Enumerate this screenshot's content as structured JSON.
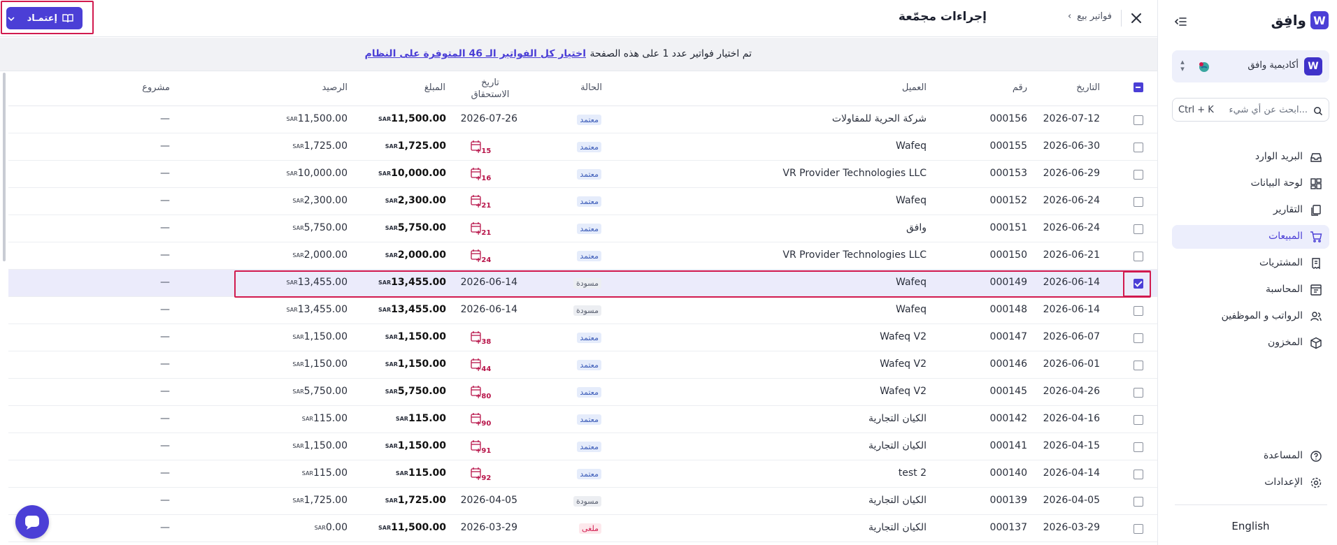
{
  "brand": {
    "logo_text": "وافِق",
    "logo_mark": "W"
  },
  "org": {
    "name": "أكاديمية وافق",
    "logo_mark": "W"
  },
  "search": {
    "placeholder": "ابحث عن أي شيء...",
    "shortcut": "Ctrl + K"
  },
  "nav": [
    {
      "label": "البريد الوارد",
      "icon": "inbox-icon"
    },
    {
      "label": "لوحة البيانات",
      "icon": "dashboard-icon"
    },
    {
      "label": "التقارير",
      "icon": "reports-icon"
    },
    {
      "label": "المبيعات",
      "icon": "cart-icon",
      "active": true
    },
    {
      "label": "المشتريات",
      "icon": "receipt-icon"
    },
    {
      "label": "المحاسبة",
      "icon": "ledger-icon"
    },
    {
      "label": "الرواتب و الموظفين",
      "icon": "users-icon"
    },
    {
      "label": "المخزون",
      "icon": "box-icon"
    }
  ],
  "bottom_nav": [
    {
      "label": "المساعدة",
      "icon": "help-icon"
    },
    {
      "label": "الإعدادات",
      "icon": "settings-icon"
    }
  ],
  "language": "English",
  "header": {
    "title": "إجراءات مجمّعة",
    "breadcrumb": [
      "فواتير بيع"
    ],
    "approve_button": "إعتمـاد"
  },
  "selection": {
    "text": "تم اختيار فواتير عدد 1 على هذه الصفحة",
    "link": "اختيار كل الفواتير الـ 46 المتوفرة على النظام"
  },
  "columns": {
    "date": "التاريخ",
    "number": "رقم",
    "client": "العميل",
    "status": "الحالة",
    "due_date": "تاريخ الاستحقاق",
    "amount": "المبلغ",
    "balance": "الرصيد",
    "project": "مشروع"
  },
  "currency": "SAR",
  "colors": {
    "accent": "#4b3fd6",
    "highlight": "#d11a4e",
    "overdue": "#b8154a"
  },
  "rows": [
    {
      "date": "2026-07-12",
      "number": "000156",
      "client": "شركة الحرية للمقاولات",
      "status": "معتمد",
      "status_type": "approved",
      "due": "2026-07-26",
      "due_days": "",
      "amount": "11,500.00",
      "balance": "11,500.00",
      "project": "—",
      "checked": false
    },
    {
      "date": "2026-06-30",
      "number": "000155",
      "client": "Wafeq",
      "status": "معتمد",
      "status_type": "approved",
      "due": "",
      "due_days": "+15",
      "amount": "1,725.00",
      "balance": "1,725.00",
      "project": "—",
      "checked": false
    },
    {
      "date": "2026-06-29",
      "number": "000153",
      "client": "VR Provider Technologies LLC",
      "status": "معتمد",
      "status_type": "approved",
      "due": "",
      "due_days": "+16",
      "amount": "10,000.00",
      "balance": "10,000.00",
      "project": "—",
      "checked": false
    },
    {
      "date": "2026-06-24",
      "number": "000152",
      "client": "Wafeq",
      "status": "معتمد",
      "status_type": "approved",
      "due": "",
      "due_days": "+21",
      "amount": "2,300.00",
      "balance": "2,300.00",
      "project": "—",
      "checked": false
    },
    {
      "date": "2026-06-24",
      "number": "000151",
      "client": "وافق",
      "status": "معتمد",
      "status_type": "approved",
      "due": "",
      "due_days": "+21",
      "amount": "5,750.00",
      "balance": "5,750.00",
      "project": "—",
      "checked": false
    },
    {
      "date": "2026-06-21",
      "number": "000150",
      "client": "VR Provider Technologies LLC",
      "status": "معتمد",
      "status_type": "approved",
      "due": "",
      "due_days": "+24",
      "amount": "2,000.00",
      "balance": "2,000.00",
      "project": "—",
      "checked": false
    },
    {
      "date": "2026-06-14",
      "number": "000149",
      "client": "Wafeq",
      "status": "مسودة",
      "status_type": "draft",
      "due": "2026-06-14",
      "due_days": "",
      "amount": "13,455.00",
      "balance": "13,455.00",
      "project": "—",
      "checked": true
    },
    {
      "date": "2026-06-14",
      "number": "000148",
      "client": "Wafeq",
      "status": "مسودة",
      "status_type": "draft",
      "due": "2026-06-14",
      "due_days": "",
      "amount": "13,455.00",
      "balance": "13,455.00",
      "project": "—",
      "checked": false
    },
    {
      "date": "2026-06-07",
      "number": "000147",
      "client": "Wafeq V2",
      "status": "معتمد",
      "status_type": "approved",
      "due": "",
      "due_days": "+38",
      "amount": "1,150.00",
      "balance": "1,150.00",
      "project": "—",
      "checked": false
    },
    {
      "date": "2026-06-01",
      "number": "000146",
      "client": "Wafeq V2",
      "status": "معتمد",
      "status_type": "approved",
      "due": "",
      "due_days": "+44",
      "amount": "1,150.00",
      "balance": "1,150.00",
      "project": "—",
      "checked": false
    },
    {
      "date": "2026-04-26",
      "number": "000145",
      "client": "Wafeq V2",
      "status": "معتمد",
      "status_type": "approved",
      "due": "",
      "due_days": "+80",
      "amount": "5,750.00",
      "balance": "5,750.00",
      "project": "—",
      "checked": false
    },
    {
      "date": "2026-04-16",
      "number": "000142",
      "client": "الكيان التجارية",
      "status": "معتمد",
      "status_type": "approved",
      "due": "",
      "due_days": "+90",
      "amount": "115.00",
      "balance": "115.00",
      "project": "—",
      "checked": false
    },
    {
      "date": "2026-04-15",
      "number": "000141",
      "client": "الكيان التجارية",
      "status": "معتمد",
      "status_type": "approved",
      "due": "",
      "due_days": "+91",
      "amount": "1,150.00",
      "balance": "1,150.00",
      "project": "—",
      "checked": false
    },
    {
      "date": "2026-04-14",
      "number": "000140",
      "client": "test 2",
      "status": "معتمد",
      "status_type": "approved",
      "due": "",
      "due_days": "+92",
      "amount": "115.00",
      "balance": "115.00",
      "project": "—",
      "checked": false
    },
    {
      "date": "2026-04-05",
      "number": "000139",
      "client": "الكيان التجارية",
      "status": "مسودة",
      "status_type": "draft",
      "due": "2026-04-05",
      "due_days": "",
      "amount": "1,725.00",
      "balance": "1,725.00",
      "project": "—",
      "checked": false
    },
    {
      "date": "2026-03-29",
      "number": "000137",
      "client": "الكيان التجارية",
      "status": "ملغى",
      "status_type": "void",
      "due": "2026-03-29",
      "due_days": "",
      "amount": "11,500.00",
      "balance": "0.00",
      "project": "—",
      "checked": false
    }
  ]
}
